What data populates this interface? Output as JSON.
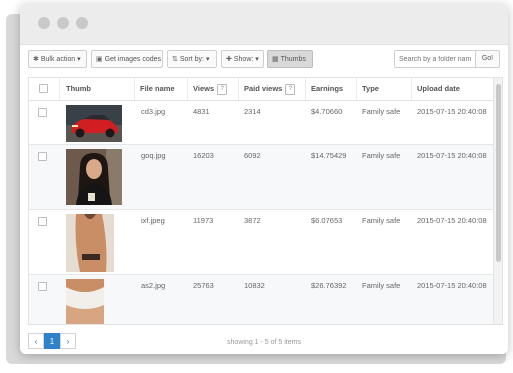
{
  "toolbar": {
    "bulk_action": "Bulk action",
    "get_codes": "Get images codes",
    "sort_by": "Sort by:",
    "show": "Show:",
    "thumbs": "Thumbs",
    "search_placeholder": "Search by a folder nam",
    "go": "Go!"
  },
  "table": {
    "columns": [
      "Thumb",
      "File name",
      "Views",
      "Paid views",
      "Earnings",
      "Type",
      "Upload date"
    ],
    "rows": [
      {
        "file": "cd3.jpg",
        "views": "4831",
        "paid_views": "2314",
        "earnings": "$4.70660",
        "type": "Family safe",
        "date": "2015-07-15 20:40:08"
      },
      {
        "file": "goq.jpg",
        "views": "16203",
        "paid_views": "6092",
        "earnings": "$14.75429",
        "type": "Family safe",
        "date": "2015-07-15 20:40:08"
      },
      {
        "file": "ixf.jpeg",
        "views": "11973",
        "paid_views": "3872",
        "earnings": "$6.07653",
        "type": "Family safe",
        "date": "2015-07-15 20:40:08"
      },
      {
        "file": "as2.jpg",
        "views": "25763",
        "paid_views": "10832",
        "earnings": "$26.76392",
        "type": "Family safe",
        "date": "2015-07-15 20:40:08"
      }
    ]
  },
  "pagination": {
    "prev": "‹",
    "page": "1",
    "next": "›",
    "status": "showing 1 - 5 of 5 items"
  },
  "colors": {
    "accent": "#2f82c8",
    "titlebar": "#ececec",
    "row_alt": "#f7f8fa"
  }
}
